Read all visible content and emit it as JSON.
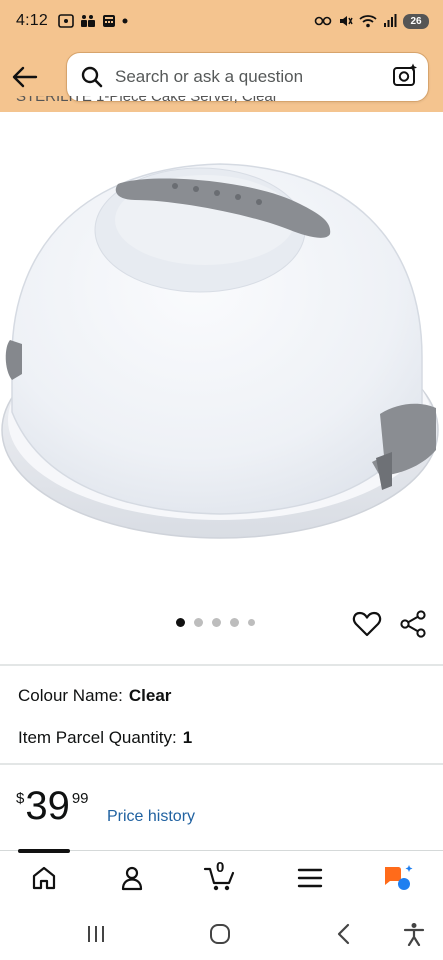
{
  "status_bar": {
    "time": "4:12",
    "battery": "26",
    "icons": [
      "screenshot-icon",
      "teams-icon",
      "calculator-icon",
      "dot-icon",
      "key-icon",
      "mute-icon",
      "wifi-icon",
      "signal-icon",
      "battery-icon"
    ]
  },
  "header": {
    "search_placeholder": "Search or ask a question",
    "icons": [
      "back-arrow-icon",
      "search-icon",
      "camera-sparkle-icon"
    ]
  },
  "product": {
    "title_partial": "STERILITE 1-Piece Cake Server, Clear",
    "image_count": 5,
    "active_image_index": 0,
    "colour_label": "Colour Name:",
    "colour_value": "Clear",
    "quantity_label": "Item Parcel Quantity:",
    "quantity_value": "1",
    "price_symbol": "$",
    "price_whole": "39",
    "price_fraction": "99",
    "price_history_link": "Price history"
  },
  "bottom_nav": {
    "items": [
      "home-icon",
      "account-icon",
      "cart-icon",
      "menu-icon",
      "rufus-assistant-icon"
    ],
    "cart_count": "0"
  },
  "colors": {
    "header_bg": "#f4c48f",
    "link": "#2162a1",
    "assistant_orange": "#ff6b1a",
    "assistant_blue": "#1f7ff0"
  }
}
